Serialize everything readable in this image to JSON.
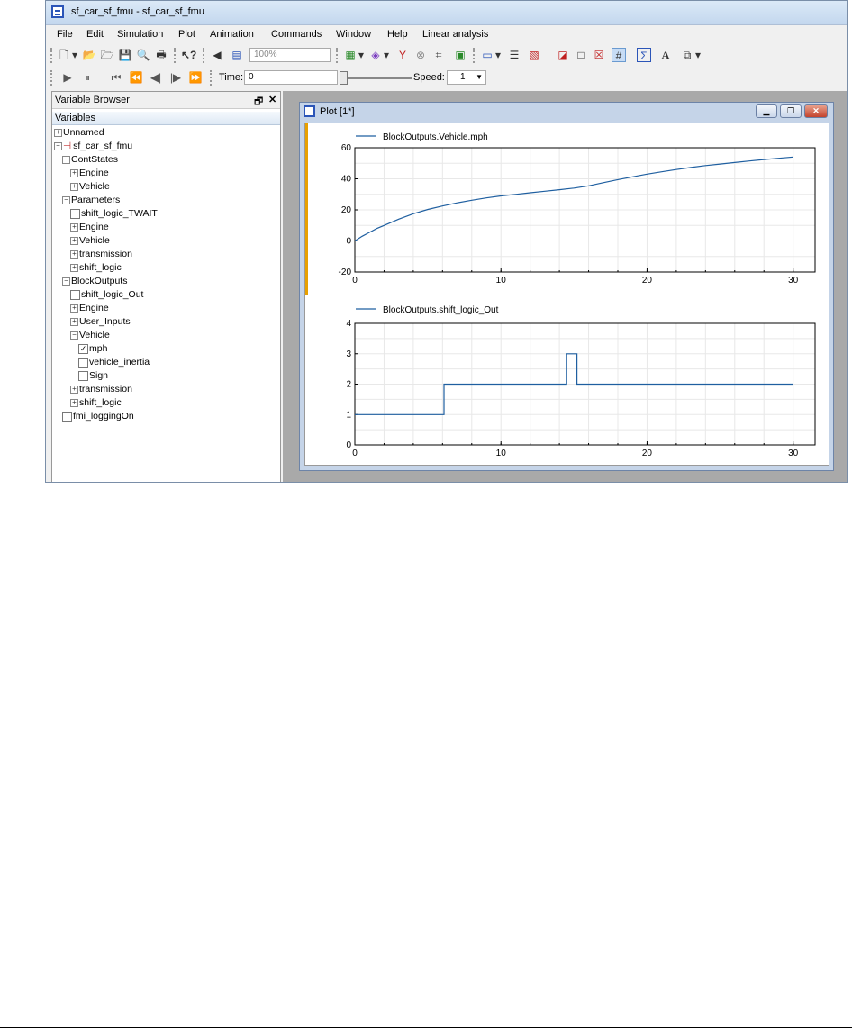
{
  "window": {
    "title": "sf_car_sf_fmu - sf_car_sf_fmu"
  },
  "menu": [
    "File",
    "Edit",
    "Simulation",
    "Plot",
    "Animation",
    "Commands",
    "Window",
    "Help",
    "Linear analysis"
  ],
  "toolbar": {
    "zoom_value": "100%",
    "time_label": "Time:",
    "time_value": "0",
    "speed_label": "Speed:",
    "speed_value": "1"
  },
  "variable_browser": {
    "title": "Variable Browser",
    "column_header": "Variables",
    "tree": [
      {
        "label": "Unnamed",
        "level": 0,
        "exp": "+"
      },
      {
        "label": "sf_car_sf_fmu",
        "level": 0,
        "exp": "-",
        "icon": "pin"
      },
      {
        "label": "ContStates",
        "level": 1,
        "exp": "-"
      },
      {
        "label": "Engine",
        "level": 2,
        "exp": "+"
      },
      {
        "label": "Vehicle",
        "level": 2,
        "exp": "+"
      },
      {
        "label": "Parameters",
        "level": 1,
        "exp": "-"
      },
      {
        "label": "shift_logic_TWAIT",
        "level": 2,
        "cb": "unchecked"
      },
      {
        "label": "Engine",
        "level": 2,
        "exp": "+"
      },
      {
        "label": "Vehicle",
        "level": 2,
        "exp": "+"
      },
      {
        "label": "transmission",
        "level": 2,
        "exp": "+"
      },
      {
        "label": "shift_logic",
        "level": 2,
        "exp": "+"
      },
      {
        "label": "BlockOutputs",
        "level": 1,
        "exp": "-"
      },
      {
        "label": "shift_logic_Out",
        "level": 2,
        "cb": "unchecked"
      },
      {
        "label": "Engine",
        "level": 2,
        "exp": "+"
      },
      {
        "label": "User_Inputs",
        "level": 2,
        "exp": "+"
      },
      {
        "label": "Vehicle",
        "level": 2,
        "exp": "-"
      },
      {
        "label": "mph",
        "level": 3,
        "cb": "checked"
      },
      {
        "label": "vehicle_inertia",
        "level": 3,
        "cb": "unchecked"
      },
      {
        "label": "Sign",
        "level": 3,
        "cb": "unchecked"
      },
      {
        "label": "transmission",
        "level": 2,
        "exp": "+"
      },
      {
        "label": "shift_logic",
        "level": 2,
        "exp": "+"
      },
      {
        "label": "fmi_loggingOn",
        "level": 1,
        "cb": "unchecked"
      }
    ]
  },
  "plot_window": {
    "title": "Plot [1*]"
  },
  "chart_data": [
    {
      "type": "line",
      "legend": "BlockOutputs.Vehicle.mph",
      "series": [
        {
          "name": "BlockOutputs.Vehicle.mph",
          "x": [
            0,
            0.5,
            1,
            1.5,
            2,
            3,
            4,
            5,
            6,
            7,
            8,
            9,
            10,
            11,
            12,
            13,
            14,
            15,
            16,
            17,
            18,
            19,
            20,
            21,
            22,
            23,
            24,
            25,
            26,
            27,
            28,
            29,
            30
          ],
          "y": [
            0,
            3,
            5.5,
            8,
            10,
            14,
            17.5,
            20.3,
            22.5,
            24.5,
            26.2,
            27.7,
            29,
            30,
            31,
            32,
            33,
            34,
            35.5,
            37.5,
            39.5,
            41.3,
            43,
            44.5,
            46,
            47.3,
            48.5,
            49.5,
            50.5,
            51.5,
            52.4,
            53.2,
            54
          ]
        }
      ],
      "xlim": [
        0,
        31.5
      ],
      "ylim": [
        -20,
        60
      ],
      "xticks": [
        0,
        10,
        20,
        30
      ],
      "yticks": [
        -20,
        0,
        20,
        40,
        60
      ],
      "line_color": "#1f5fa0"
    },
    {
      "type": "line",
      "legend": "BlockOutputs.shift_logic_Out",
      "series": [
        {
          "name": "BlockOutputs.shift_logic_Out",
          "x": [
            0,
            6.1,
            6.1,
            14.5,
            14.5,
            15.2,
            15.2,
            30
          ],
          "y": [
            1,
            1,
            2,
            2,
            3,
            3,
            2,
            2
          ]
        }
      ],
      "xlim": [
        0,
        31.5
      ],
      "ylim": [
        0,
        4
      ],
      "xticks": [
        0,
        10,
        20,
        30
      ],
      "yticks": [
        0,
        1,
        2,
        3,
        4
      ],
      "line_color": "#1f5fa0"
    }
  ]
}
